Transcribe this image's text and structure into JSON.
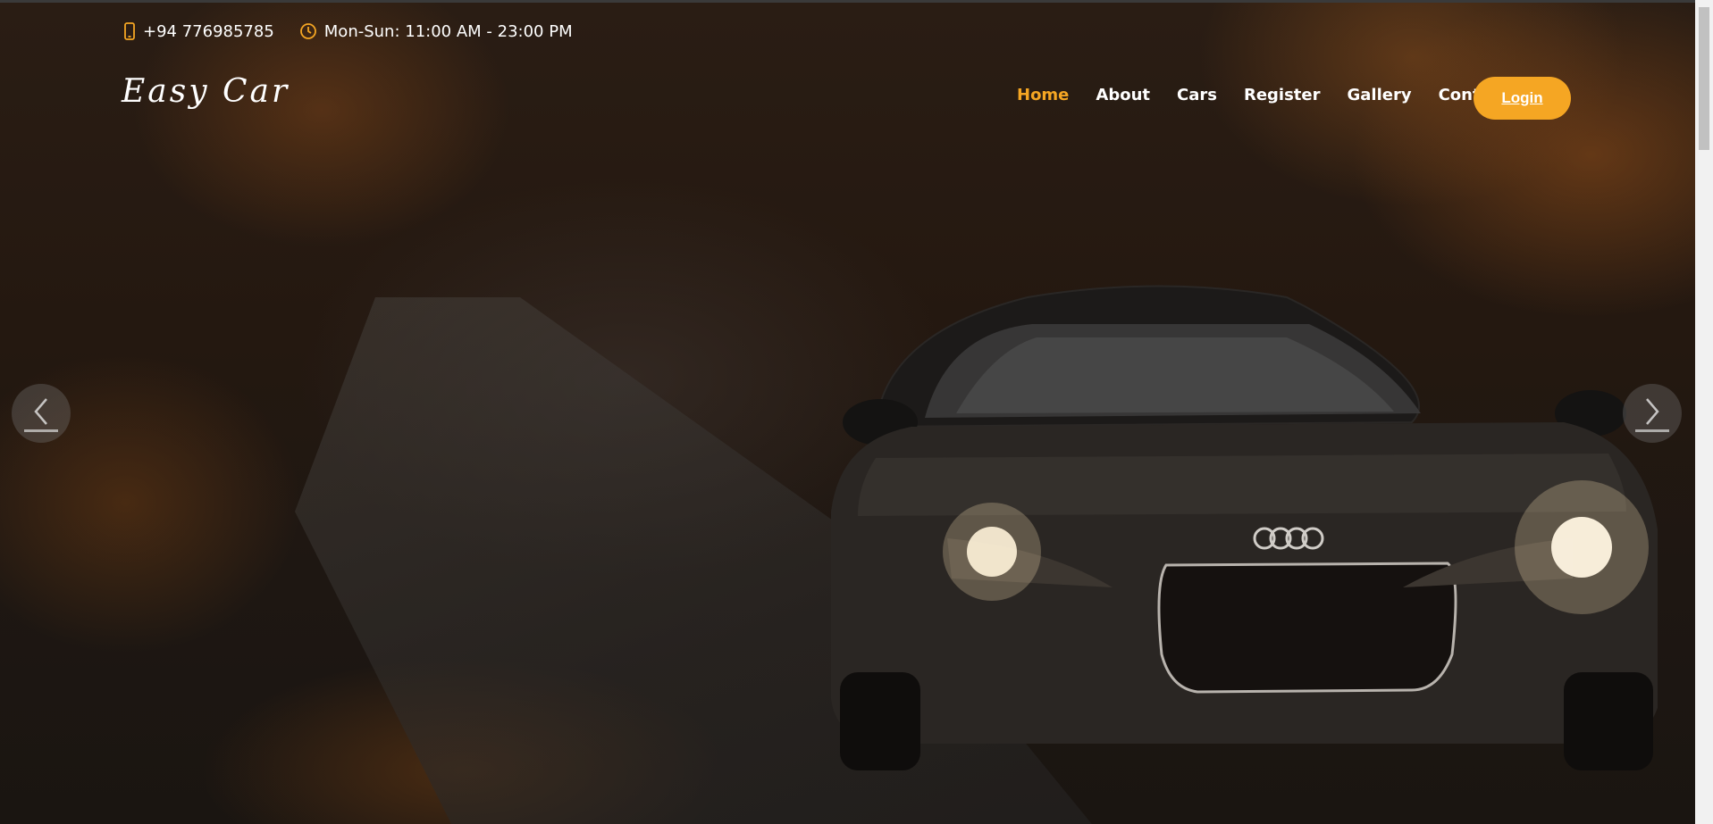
{
  "topbar": {
    "phone": "+94 776985785",
    "hours": "Mon-Sun: 11:00 AM - 23:00 PM"
  },
  "brand": {
    "logo_text": "Easy Car"
  },
  "nav": {
    "items": [
      "Home",
      "About",
      "Cars",
      "Register",
      "Gallery",
      "Contact"
    ],
    "active_index": 0,
    "login_label": "Login"
  },
  "colors": {
    "accent": "#f5a623",
    "text": "#ffffff"
  },
  "icons": {
    "phone": "phone-icon",
    "clock": "clock-icon",
    "prev": "chevron-left-icon",
    "next": "chevron-right-icon"
  }
}
